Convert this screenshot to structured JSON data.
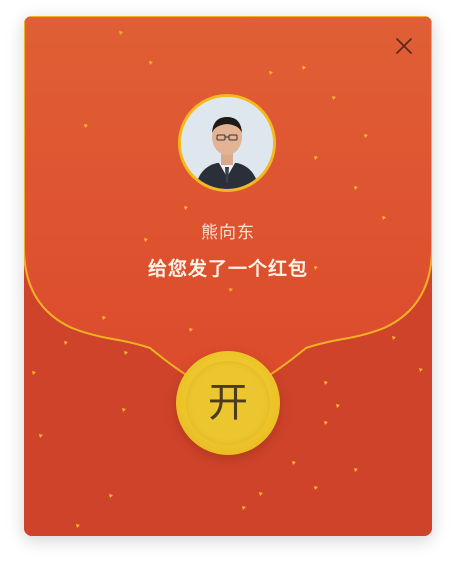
{
  "dialog": {
    "close_icon": "close-icon",
    "sender_name": "熊向东",
    "greeting": "给您发了一个红包",
    "open_label": "开",
    "avatar_icon": "user-avatar"
  },
  "colors": {
    "envelope_top": "#e45c33",
    "envelope_bottom": "#cf432b",
    "gold": "#f3b91f",
    "coin": "#ecc62e"
  }
}
